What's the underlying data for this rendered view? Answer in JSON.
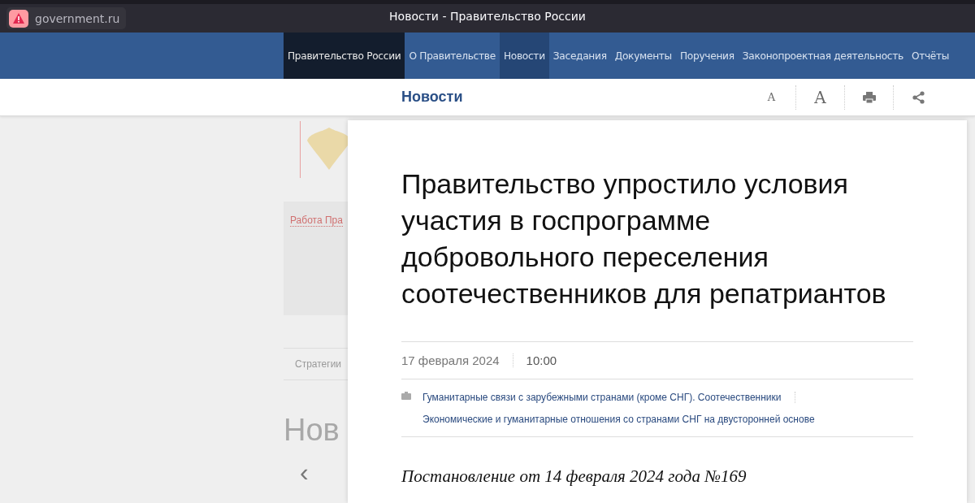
{
  "browser": {
    "address": "government.ru",
    "title": "Новости - Правительство России"
  },
  "nav": [
    {
      "label": "Правительство России",
      "kind": "home",
      "selected": false
    },
    {
      "label": "О Правительстве",
      "kind": "link",
      "selected": false
    },
    {
      "label": "Новости",
      "kind": "link",
      "selected": true
    },
    {
      "label": "Заседания",
      "kind": "link",
      "selected": false
    },
    {
      "label": "Документы",
      "kind": "link",
      "selected": false
    },
    {
      "label": "Поручения",
      "kind": "link",
      "selected": false
    },
    {
      "label": "Законопроектная деятельность",
      "kind": "link",
      "selected": false
    },
    {
      "label": "Отчёты",
      "kind": "link",
      "selected": false
    }
  ],
  "header": {
    "section": "Новости",
    "font_small": "A",
    "font_large": "A"
  },
  "background_page": {
    "link": "Работа Пра",
    "tab": "Стратегии",
    "heading": "Нов",
    "prev": "‹"
  },
  "article": {
    "title": "Правительство упростило условия участия в госпрограмме добровольного переселения соотечественников для репатриантов",
    "date": "17 февраля 2024",
    "time": "10:00",
    "topics": [
      "Гуманитарные связи с зарубежными странами (кроме СНГ). Соотечественники",
      "Экономические и гуманитарные отношения со странами СНГ на двусторонней основе"
    ],
    "decree": "Постановление от 14 февраля 2024 года №169"
  }
}
